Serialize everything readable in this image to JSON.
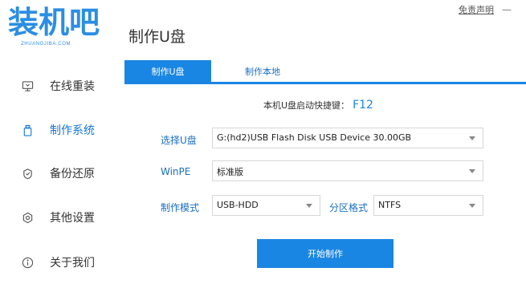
{
  "app": {
    "logo_text": "装机吧",
    "logo_subtext": "ZHUANGJIBA.COM",
    "page_title": "制作U盘",
    "disclaimer": "免责声明",
    "minimize_symbol": "—"
  },
  "sidebar": {
    "items": [
      {
        "label": "在线重装",
        "icon": "monitor-icon"
      },
      {
        "label": "制作系统",
        "icon": "usb-drive-icon",
        "active": true
      },
      {
        "label": "备份还原",
        "icon": "backup-restore-icon"
      },
      {
        "label": "其他设置",
        "icon": "gear-icon"
      },
      {
        "label": "关于我们",
        "icon": "info-icon"
      }
    ]
  },
  "tabs": [
    {
      "label": "制作U盘",
      "active": true
    },
    {
      "label": "制作本地",
      "active": false
    }
  ],
  "hotkey": {
    "label": "本机U盘启动快捷键：",
    "key": "F12"
  },
  "form": {
    "usb_label": "选择U盘",
    "usb_value": "G:(hd2)USB Flash Disk USB Device 30.00GB",
    "winpe_label": "WinPE",
    "winpe_value": "标准版",
    "mode_label": "制作模式",
    "mode_value": "USB-HDD",
    "partition_label": "分区格式",
    "partition_value": "NTFS"
  },
  "start_button": "开始制作",
  "colors": {
    "accent": "#1a86e3",
    "logo": "#2b8ee3",
    "label_blue": "#1a6fbf"
  }
}
